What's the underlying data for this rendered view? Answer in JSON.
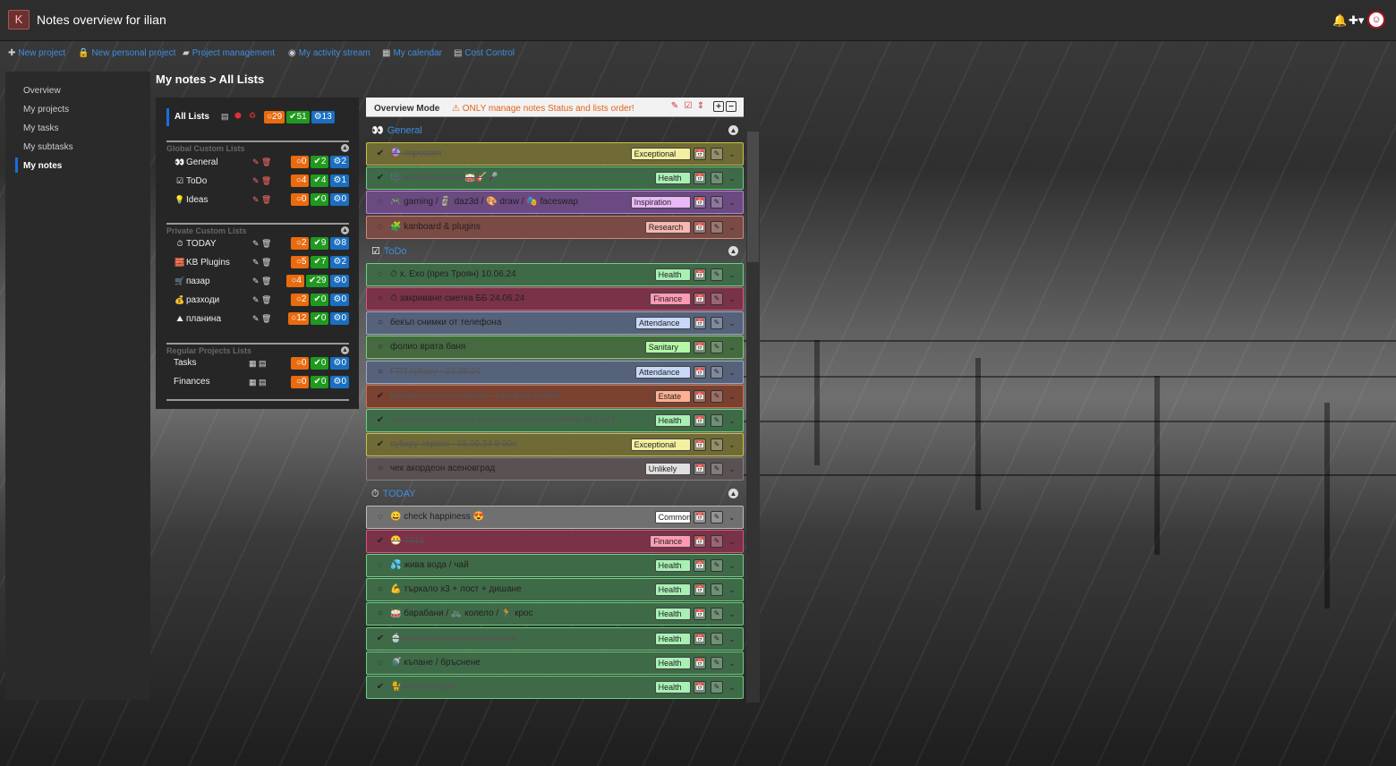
{
  "app": {
    "title": "Notes overview for ilian",
    "logo": "kanboard-logo"
  },
  "topbar": {
    "notifications_icon": "bell-icon",
    "add_icon": "plus-icon",
    "avatar_icon": "user-avatar"
  },
  "menubar": [
    {
      "icon": "plus-icon",
      "glyph": "✚",
      "label": "New project"
    },
    {
      "icon": "lock-icon",
      "glyph": "🔒",
      "label": "New personal project"
    },
    {
      "icon": "folder-icon",
      "glyph": "▰",
      "label": "Project management"
    },
    {
      "icon": "dashboard-icon",
      "glyph": "◉",
      "label": "My activity stream"
    },
    {
      "icon": "calendar-icon",
      "glyph": "▦",
      "label": "My calendar"
    },
    {
      "icon": "cost-control-icon",
      "glyph": "▤",
      "label": "Cost Control"
    }
  ],
  "sidenav": [
    "Overview",
    "My projects",
    "My tasks",
    "My subtasks",
    "My notes"
  ],
  "breadcrumb": "My notes > All Lists",
  "all_lists": {
    "label": "All Lists",
    "open": "29",
    "done": "51",
    "total": "13"
  },
  "sections": {
    "global": "Global Custom Lists",
    "private": "Private Custom Lists",
    "regular": "Regular Projects Lists"
  },
  "global_lists": [
    {
      "icon": "👀",
      "name": "General",
      "open": "0",
      "done": "2",
      "total": "2"
    },
    {
      "icon": "☑",
      "name": "ToDo",
      "open": "4",
      "done": "4",
      "total": "1"
    },
    {
      "icon": "💡",
      "name": "Ideas",
      "open": "0",
      "done": "0",
      "total": "0"
    }
  ],
  "private_lists": [
    {
      "icon": "⏱",
      "name": "TODAY",
      "open": "2",
      "done": "9",
      "total": "8"
    },
    {
      "icon": "🧱",
      "name": "KB Plugins",
      "open": "5",
      "done": "7",
      "total": "2"
    },
    {
      "icon": "🛒",
      "name": "пазар",
      "open": "4",
      "done": "29",
      "total": "0"
    },
    {
      "icon": "💰",
      "name": "разходи",
      "open": "2",
      "done": "0",
      "total": "0"
    },
    {
      "icon": "⛰",
      "name": "планина",
      "open": "12",
      "done": "0",
      "total": "0"
    }
  ],
  "regular_lists": [
    {
      "name": "Tasks",
      "open": "0",
      "done": "0",
      "total": "0"
    },
    {
      "name": "Finances",
      "open": "0",
      "done": "0",
      "total": "0"
    }
  ],
  "overview": {
    "title": "Overview Mode",
    "warning": "ONLY manage notes Status and lists order!"
  },
  "groups": [
    {
      "icon": "👀",
      "name": "General",
      "notes": [
        {
          "status": "done",
          "text": "🔮 хороскоп",
          "tag": "Exceptional",
          "tagcolor": "#f4f0a0",
          "color": "#6f6a36",
          "border": "#c8c24a"
        },
        {
          "status": "done",
          "text": "🎼 репетиционна 🥁🎸🎤",
          "tag": "Health",
          "tagcolor": "#a8f0b4",
          "color": "#3f6a48",
          "border": "#6ed082"
        },
        {
          "status": "progress",
          "text": "🎮 gaming / 🗿 daz3d / 🎨 draw / 🎭 faceswap",
          "tag": "Inspiration",
          "tagcolor": "#e8b8f8",
          "color": "#6a4a80",
          "border": "#b884d8"
        },
        {
          "status": "progress",
          "text": "🧩 kanboard & plugins",
          "tag": "Research",
          "tagcolor": "#f6b8b0",
          "color": "#7a4a44",
          "border": "#d08880"
        }
      ]
    },
    {
      "icon": "☑",
      "name": "ToDo",
      "notes": [
        {
          "status": "progress",
          "text": "⏱ х. Ехо (през Троян) 10.06.24",
          "tag": "Health",
          "tagcolor": "#a8f0b4",
          "color": "#3f6a48",
          "border": "#6ed082"
        },
        {
          "status": "open",
          "text": "⏱ закриване сметка ББ 24.06.24",
          "tag": "Finance",
          "tagcolor": "#ff9ab4",
          "color": "#7a3248",
          "border": "#d05a7a"
        },
        {
          "status": "open",
          "text": "бекъп снимки от телефона",
          "tag": "Attendance",
          "tagcolor": "#c8d8f8",
          "color": "#56627a",
          "border": "#98a8c8"
        },
        {
          "status": "open",
          "text": "фолио врата баня",
          "tag": "Sanitary",
          "tagcolor": "#b4f8a8",
          "color": "#456a40",
          "border": "#7ad070"
        },
        {
          "status": "open",
          "text": "ГТП субару - 22.05.24",
          "tag": "Attendance",
          "tagcolor": "#c8d8f8",
          "color": "#56627a",
          "border": "#98a8c8",
          "strike": true
        },
        {
          "status": "done",
          "text": "реален отчет ток места - 13.05.24 10:00ч",
          "tag": "Estate",
          "tagcolor": "#ffb090",
          "color": "#7a4030",
          "border": "#d0704a"
        },
        {
          "status": "done",
          "text": "тел ябълков оцет петрич, росен стоилов 0886 667 447",
          "tag": "Health",
          "tagcolor": "#a8f0b4",
          "color": "#3f6a48",
          "border": "#6ed082"
        },
        {
          "status": "done",
          "text": "субару сервиз - 03.06.24 9:00ч",
          "tag": "Exceptional",
          "tagcolor": "#f4f0a0",
          "color": "#6f6a36",
          "border": "#c8c24a"
        },
        {
          "status": "open",
          "text": "чек акордеон асеновград",
          "tag": "Unlikely",
          "tagcolor": "#e0e0e0",
          "color": "#5a5252",
          "border": "#8a8080"
        }
      ]
    },
    {
      "icon": "⏱",
      "name": "TODAY",
      "notes": [
        {
          "status": "progress",
          "text": "😀 check happiness 😍",
          "tag": "Common",
          "tagcolor": "#ffffff",
          "color": "#707070",
          "border": "#bbbbbb"
        },
        {
          "status": "done",
          "text": "😷 T212",
          "tag": "Finance",
          "tagcolor": "#ff9ab4",
          "color": "#7a3248",
          "border": "#d05a7a"
        },
        {
          "status": "progress",
          "text": "💦 жива вода / чай",
          "tag": "Health",
          "tagcolor": "#a8f0b4",
          "color": "#3f6a48",
          "border": "#6ed082"
        },
        {
          "status": "open",
          "text": "💪 търкало x3 + лост + дишане",
          "tag": "Health",
          "tagcolor": "#a8f0b4",
          "color": "#3f6a48",
          "border": "#6ed082"
        },
        {
          "status": "open",
          "text": "🥁 барабани / 🚲 колело / 🏃 крос",
          "tag": "Health",
          "tagcolor": "#a8f0b4",
          "color": "#3f6a48",
          "border": "#6ed082"
        },
        {
          "status": "done",
          "text": "🍵 детокс / сауна / накръщина",
          "tag": "Health",
          "tagcolor": "#a8f0b4",
          "color": "#3f6a48",
          "border": "#6ed082"
        },
        {
          "status": "progress",
          "text": "🚿 къпане / бръснене",
          "tag": "Health",
          "tagcolor": "#a8f0b4",
          "color": "#3f6a48",
          "border": "#6ed082"
        },
        {
          "status": "done",
          "text": "🐈 котанизация",
          "tag": "Health",
          "tagcolor": "#a8f0b4",
          "color": "#3f6a48",
          "border": "#6ed082"
        }
      ]
    }
  ]
}
